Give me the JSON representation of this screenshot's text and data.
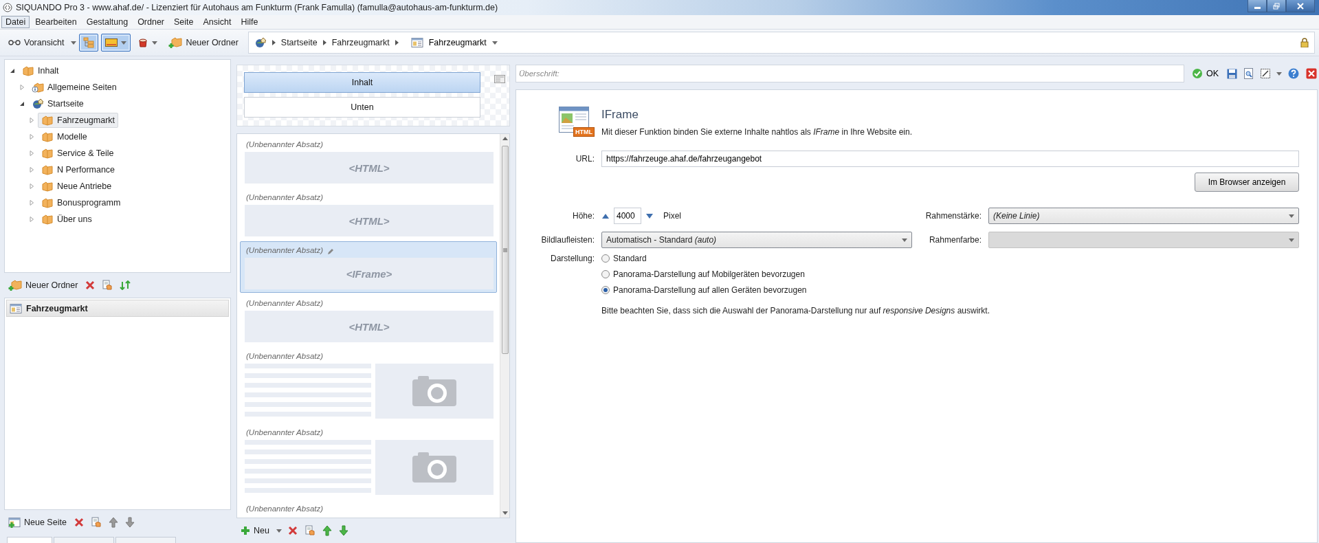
{
  "window": {
    "title": "SIQUANDO Pro 3 - www.ahaf.de/ - Lizenziert für Autohaus am Funkturm (Frank Famulla) (famulla@autohaus-am-funkturm.de)"
  },
  "menu": [
    {
      "label": "Datei",
      "selected": true
    },
    {
      "label": "Bearbeiten",
      "selected": false
    },
    {
      "label": "Gestaltung",
      "selected": false
    },
    {
      "label": "Ordner",
      "selected": false
    },
    {
      "label": "Seite",
      "selected": false
    },
    {
      "label": "Ansicht",
      "selected": false
    },
    {
      "label": "Hilfe",
      "selected": false
    }
  ],
  "toolbar": {
    "preview_button": "Voransicht",
    "view_toggles": [
      {
        "kind": "tree",
        "on": true
      },
      {
        "kind": "image",
        "on": true
      },
      {
        "kind": "style",
        "on": false
      }
    ],
    "new_folder_button": "Neuer Ordner"
  },
  "breadcrumb": {
    "items": [
      "Startseite",
      "Fahrzeugmarkt"
    ],
    "page": "Fahrzeugmarkt"
  },
  "tree": [
    {
      "label": "Inhalt",
      "kind": "folder",
      "expanded": true,
      "selected": false,
      "children": [
        {
          "label": "Allgemeine Seiten",
          "kind": "info",
          "expanded": false,
          "selected": false
        },
        {
          "label": "Startseite",
          "kind": "globe",
          "expanded": true,
          "selected": false,
          "children": [
            {
              "label": "Fahrzeugmarkt",
              "kind": "folder",
              "expanded": false,
              "selected": true
            },
            {
              "label": "Modelle",
              "kind": "folder",
              "expanded": false,
              "selected": false
            },
            {
              "label": "Service & Teile",
              "kind": "folder",
              "expanded": false,
              "selected": false
            },
            {
              "label": "N Performance",
              "kind": "folder",
              "expanded": false,
              "selected": false
            },
            {
              "label": "Neue Antriebe",
              "kind": "folder",
              "expanded": false,
              "selected": false
            },
            {
              "label": "Bonusprogramm",
              "kind": "folder",
              "expanded": false,
              "selected": false
            },
            {
              "label": "Über uns",
              "kind": "folder",
              "expanded": false,
              "selected": false
            }
          ]
        }
      ]
    }
  ],
  "folder_toolbar": {
    "new_button": "Neuer Ordner"
  },
  "pages": [
    {
      "label": "Fahrzeugmarkt",
      "selected": true
    }
  ],
  "page_toolbar": {
    "new_button": "Neue Seite"
  },
  "areas": [
    {
      "label": "Inhalt",
      "selected": true
    },
    {
      "label": "Unten",
      "selected": false
    }
  ],
  "paragraphs": [
    {
      "title": "(Unbenannter Absatz)",
      "kind": "html",
      "preview": "<HTML>",
      "selected": false
    },
    {
      "title": "(Unbenannter Absatz)",
      "kind": "html",
      "preview": "<HTML>",
      "selected": false
    },
    {
      "title": "(Unbenannter Absatz)",
      "kind": "html",
      "preview": "<IFrame>",
      "selected": true
    },
    {
      "title": "(Unbenannter Absatz)",
      "kind": "html",
      "preview": "<HTML>",
      "selected": false
    },
    {
      "title": "(Unbenannter Absatz)",
      "kind": "image",
      "selected": false
    },
    {
      "title": "(Unbenannter Absatz)",
      "kind": "image",
      "selected": false
    },
    {
      "title": "(Unbenannter Absatz)",
      "kind": "cut",
      "selected": false
    }
  ],
  "paragraph_toolbar": {
    "new_button": "Neu"
  },
  "editor": {
    "heading_placeholder": "Überschrift:",
    "ok_button": "OK",
    "module": {
      "title": "IFrame",
      "icon_label": "HTML",
      "description": "Mit dieser Funktion binden Sie externe Inhalte nahtlos als *IFrame* in Ihre Website ein."
    },
    "url": {
      "label": "URL:",
      "value": "https://fahrzeuge.ahaf.de/fahrzeugangebot"
    },
    "browser_button": "Im Browser anzeigen",
    "height": {
      "label": "Höhe:",
      "value": "4000",
      "unit": "Pixel"
    },
    "border_width": {
      "label": "Rahmenstärke:",
      "value": "(Keine Linie)"
    },
    "scrollbars": {
      "label": "Bildlaufleisten:",
      "value": "Automatisch - Standard *(auto)*"
    },
    "border_color": {
      "label": "Rahmenfarbe:",
      "disabled": true
    },
    "display": {
      "label": "Darstellung:",
      "options": [
        {
          "label": "Standard",
          "selected": false
        },
        {
          "label": "Panorama-Darstellung auf Mobilgeräten bevorzugen",
          "selected": false
        },
        {
          "label": "Panorama-Darstellung auf allen Geräten bevorzugen",
          "selected": true
        }
      ]
    },
    "note": "Bitte beachten Sie, dass sich die Auswahl der Panorama-Darstellung nur auf *responsive Designs* auswirkt."
  },
  "bottom_tabs": [
    {
      "selected": true
    },
    {
      "selected": false
    },
    {
      "selected": false
    }
  ]
}
